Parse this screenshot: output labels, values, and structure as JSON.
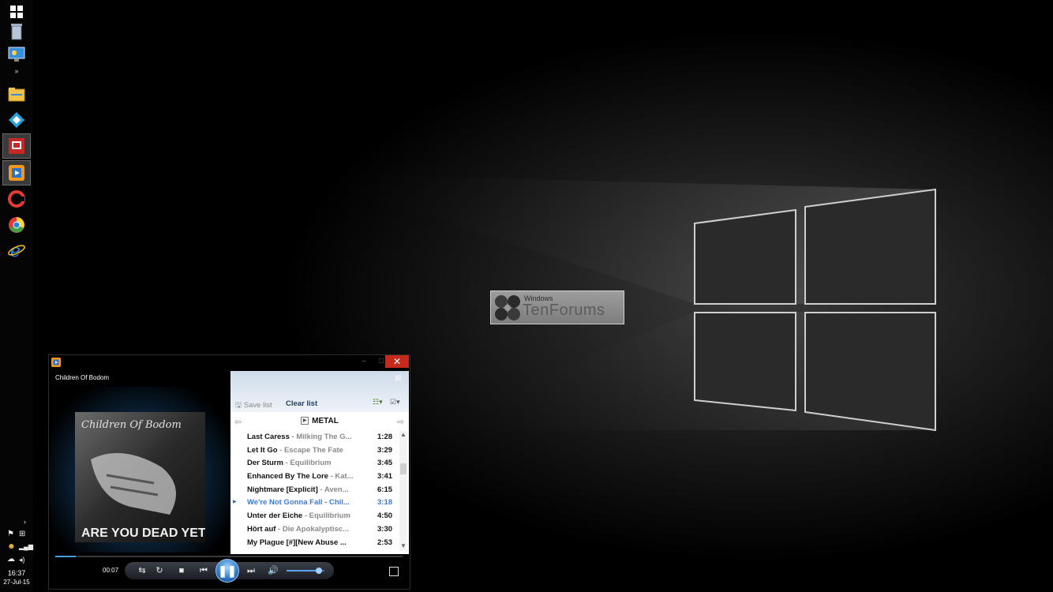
{
  "taskbar": {
    "apps": [
      "start-icon",
      "recycle-bin-icon",
      "control-panel-icon",
      "expand-icon",
      "file-explorer-icon",
      "kodi-icon",
      "network-app-icon",
      "media-player-icon",
      "ccleaner-icon",
      "chrome-icon",
      "internet-explorer-icon"
    ],
    "tray": {
      "expand": "›",
      "time": "16:37",
      "date": "27-Jul-15"
    }
  },
  "watermark": {
    "line1": "Windows",
    "line2": "TenForums"
  },
  "player": {
    "window_controls": {
      "minimize": "–",
      "maximize": "□",
      "close": "✕"
    },
    "now_playing": "Children Of Bodom",
    "album_art": {
      "band": "Children Of Bodom",
      "title": "ARE YOU DEAD YET?"
    },
    "playlist": {
      "save_label": "Save list",
      "clear_label": "Clear list",
      "name": "METAL",
      "tracks": [
        {
          "title": "Last Caress",
          "artist": " - Milking The G...",
          "duration": "1:28",
          "current": false
        },
        {
          "title": "Let It Go",
          "artist": " - Escape The Fate",
          "duration": "3:29",
          "current": false
        },
        {
          "title": "Der Sturm",
          "artist": " - Equilibrium",
          "duration": "3:45",
          "current": false
        },
        {
          "title": "Enhanced By The Lore",
          "artist": " - Kat...",
          "duration": "3:41",
          "current": false
        },
        {
          "title": "Nightmare [Explicit]",
          "artist": " - Aven...",
          "duration": "6:15",
          "current": false
        },
        {
          "title": "We're Not Gonna Fall",
          "artist": " - Chil...",
          "duration": "3:18",
          "current": true
        },
        {
          "title": "Unter der Eiche",
          "artist": " - Equilibrium",
          "duration": "4:50",
          "current": false
        },
        {
          "title": "Hört auf",
          "artist": " - Die Apokalyptisc...",
          "duration": "3:30",
          "current": false
        },
        {
          "title": "My Plague [#][New Abuse ...",
          "artist": "",
          "duration": "2:53",
          "current": false
        }
      ]
    },
    "playback": {
      "elapsed": "00:07",
      "progress": 0.06,
      "volume": 0.85,
      "buttons": {
        "shuffle": "⇆",
        "repeat": "↻",
        "stop": "■",
        "previous": "⏮",
        "play_pause": "❚❚",
        "next": "⏭",
        "mute": "🔊"
      }
    },
    "colors": {
      "accent": "#3d7bd6",
      "close": "#c42b1c"
    }
  }
}
